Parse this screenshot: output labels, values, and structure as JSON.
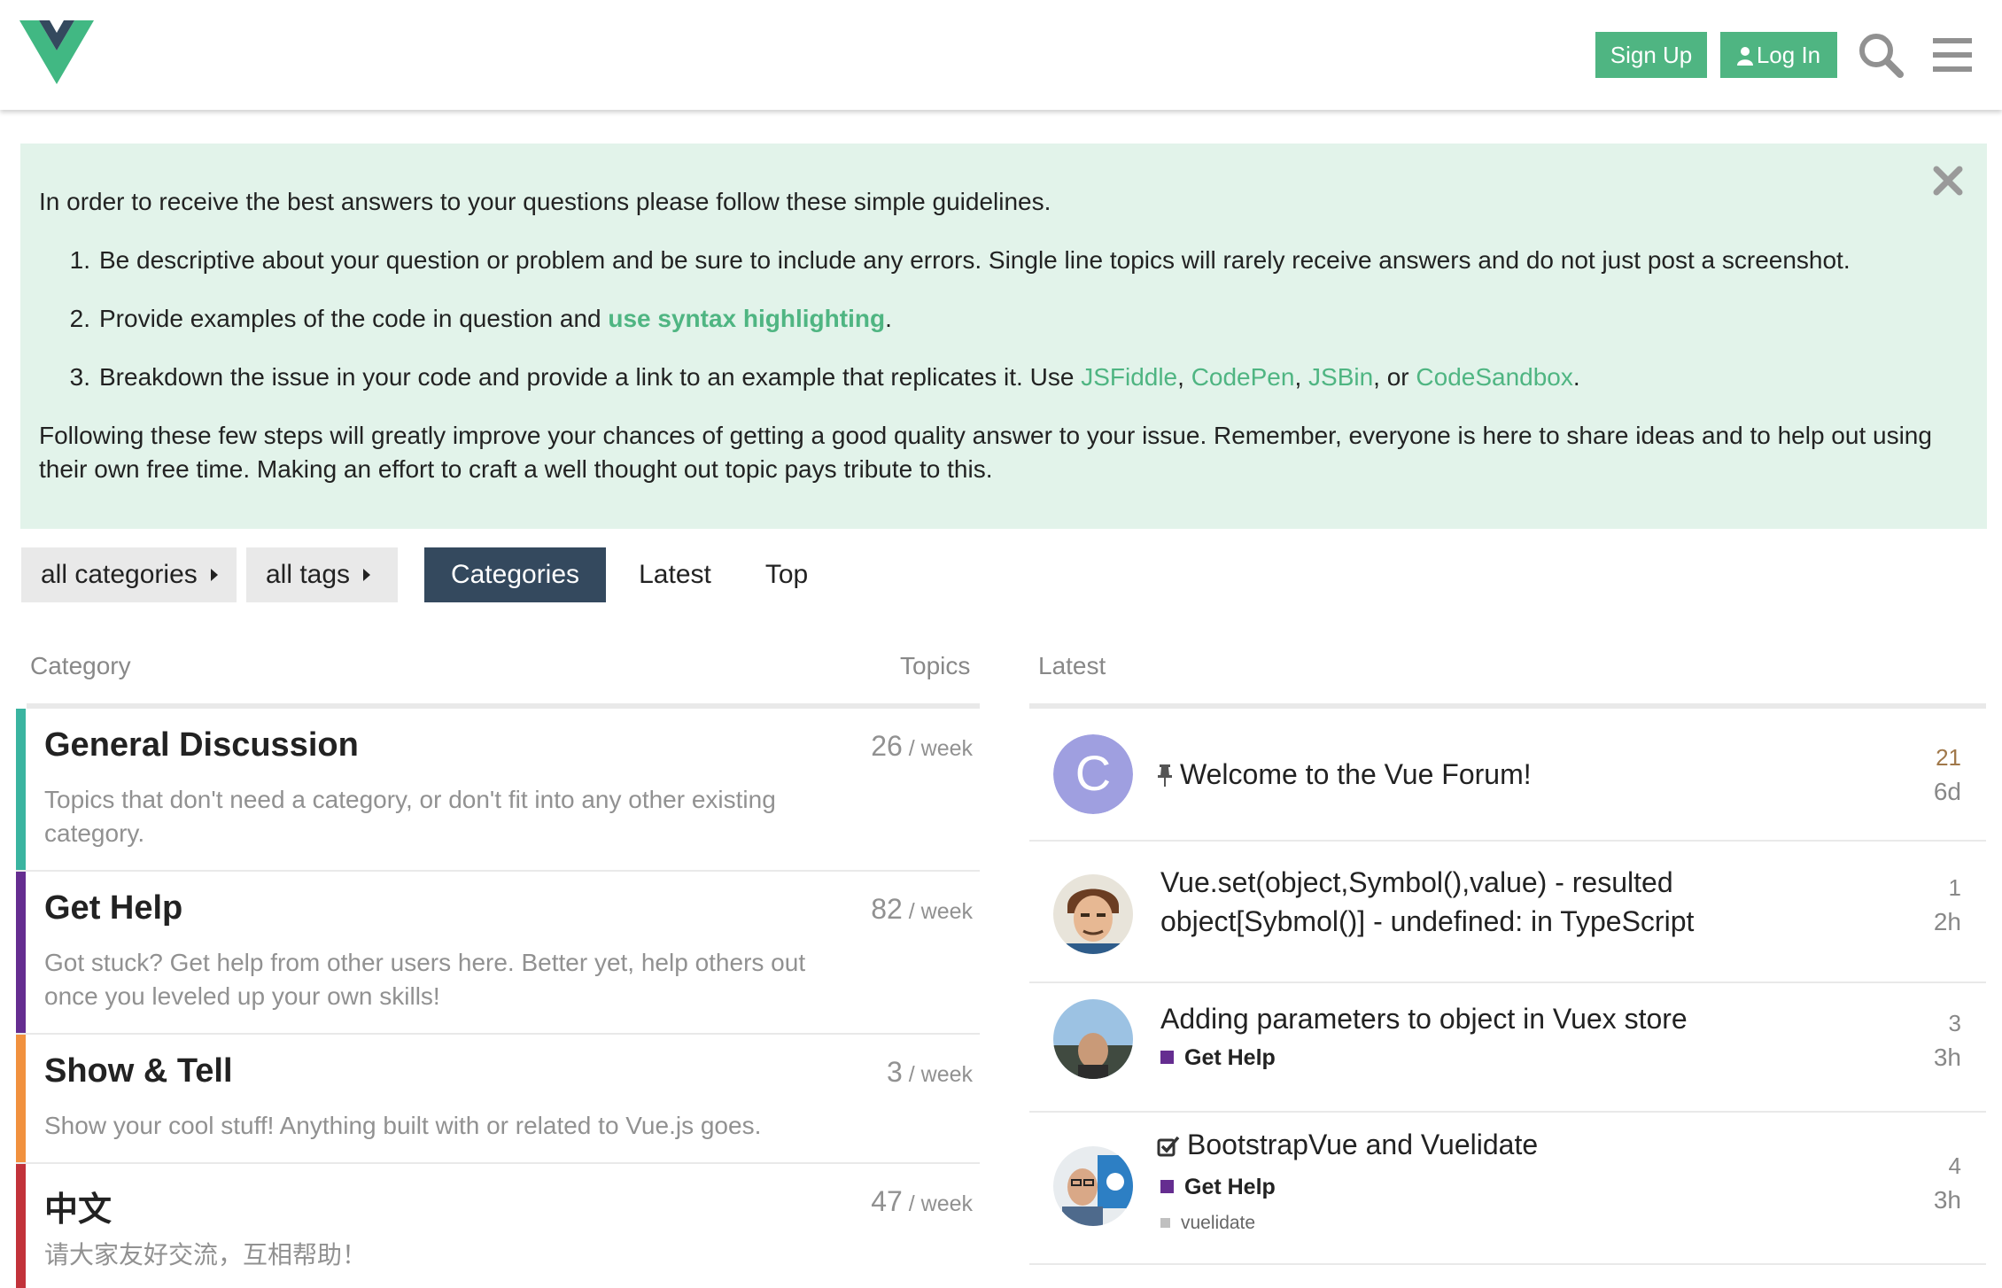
{
  "header": {
    "logo_icon": "vue-logo",
    "signup_label": "Sign Up",
    "login_label": "Log In",
    "search_icon": "search-icon",
    "menu_icon": "hamburger-menu-icon",
    "accent_color": "#4fb582"
  },
  "banner": {
    "intro": "In order to receive the best answers to your questions please follow these simple guidelines.",
    "item1_num": "1.",
    "item1_text": "Be descriptive about your question or problem and be sure to include any errors. Single line topics will rarely receive answers and do not just post a screenshot.",
    "item2_num": "2.",
    "item2_before": "Provide examples of the code in question and ",
    "item2_link": "use syntax highlighting",
    "item2_after": ".",
    "item3_num": "3.",
    "item3_before": "Breakdown the issue in your code and provide a link to an example that replicates it. Use ",
    "item3_link1": "JSFiddle",
    "sep1": ", ",
    "item3_link2": "CodePen",
    "sep2": ", ",
    "item3_link3": "JSBin",
    "sep3": ", or ",
    "item3_link4": "CodeSandbox",
    "item3_after": ".",
    "outro_line1": "Following these few steps will greatly improve your chances of getting a good quality answer to your issue. Remember, everyone is here to share ideas and to help out using",
    "outro_line2": "their own free time. Making an effort to craft a well thought out topic pays tribute to this.",
    "background": "#e2f3ea"
  },
  "nav": {
    "all_categories": "all categories",
    "all_tags": "all tags",
    "tab_categories": "Categories",
    "tab_latest": "Latest",
    "tab_top": "Top",
    "active_color": "#34495e"
  },
  "table": {
    "col_category": "Category",
    "col_topics": "Topics",
    "col_latest": "Latest"
  },
  "categories": [
    {
      "name": "General Discussion",
      "desc_line1": "Topics that don't need a category, or don't fit into any other existing",
      "desc_line2": "category.",
      "count": "26",
      "per": " / week",
      "color": "#3ab4a0"
    },
    {
      "name": "Get Help",
      "desc_line1": "Got stuck? Get help from other users here. Better yet, help others out",
      "desc_line2": "once you leveled up your own skills!",
      "count": "82",
      "per": " / week",
      "color": "#652d90"
    },
    {
      "name": "Show & Tell",
      "desc_line1": "Show your cool stuff! Anything built with or related to Vue.js goes.",
      "count": "3",
      "per": " / week",
      "color": "#f1913e"
    },
    {
      "name": "中文",
      "desc_line1": "请大家友好交流，互相帮助！",
      "count": "47",
      "per": " / week",
      "color": "#c2323a"
    }
  ],
  "topics": [
    {
      "title": "Welcome to the Vue Forum!",
      "pinned": true,
      "avatar_letter": "C",
      "avatar_color": "#9f9fe0",
      "posts": "21",
      "posts_color": "#a0784a",
      "age": "6d"
    },
    {
      "title_line1": "Vue.set(object,Symbol(),value) - resulted",
      "title_line2": "object[Sybmol()] - undefined: in TypeScript",
      "posts": "1",
      "age": "2h"
    },
    {
      "title": "Adding parameters to object in Vuex store",
      "category": "Get Help",
      "posts": "3",
      "age": "3h"
    },
    {
      "title": "BootstrapVue and Vuelidate",
      "solved": true,
      "category": "Get Help",
      "tag": "vuelidate",
      "posts": "4",
      "age": "3h"
    }
  ]
}
